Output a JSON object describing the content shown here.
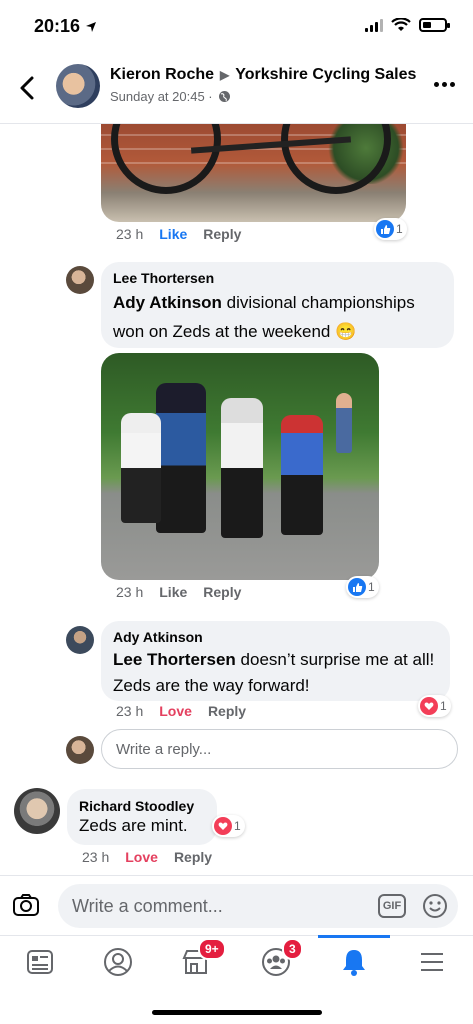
{
  "status_bar": {
    "time": "20:16"
  },
  "header": {
    "author": "Kieron Roche",
    "group": "Yorkshire Cycling Sales",
    "subtitle": "Sunday at 20:45 ·"
  },
  "first_comment": {
    "time": "23 h",
    "like_label": "Like",
    "reply_label": "Reply",
    "reaction_count": "1"
  },
  "comment_lee": {
    "name": "Lee Thortersen",
    "mention": "Ady Atkinson",
    "text": " divisional championships won on Zeds at the weekend 😁",
    "time": "23 h",
    "like_label": "Like",
    "reply_label": "Reply",
    "reaction_count": "1"
  },
  "comment_ady": {
    "name": "Ady Atkinson",
    "mention": "Lee Thortersen",
    "text": " doesn’t surprise me at all! Zeds are the way forward!",
    "time": "23 h",
    "love_label": "Love",
    "reply_label": "Reply",
    "reaction_count": "1"
  },
  "reply_box": {
    "placeholder": "Write a reply..."
  },
  "comment_richard": {
    "name": "Richard Stoodley",
    "text": "Zeds are mint.",
    "time": "23 h",
    "love_label": "Love",
    "reply_label": "Reply",
    "reaction_count": "1"
  },
  "composer": {
    "placeholder": "Write a comment...",
    "gif_label": "GIF"
  },
  "tabs": {
    "marketplace_badge": "9+",
    "groups_badge": "3"
  },
  "colors": {
    "facebook_blue": "#1877f2",
    "love_red": "#e4405f",
    "bubble_gray": "#f0f2f5",
    "badge_red": "#e41e3f"
  },
  "icons": [
    "back-arrow-icon",
    "globe-icon",
    "more-icon",
    "like-icon",
    "love-icon",
    "camera-icon",
    "gif-icon",
    "emoji-icon",
    "news-feed-icon",
    "profile-icon",
    "marketplace-icon",
    "groups-icon",
    "bell-icon",
    "menu-icon"
  ]
}
